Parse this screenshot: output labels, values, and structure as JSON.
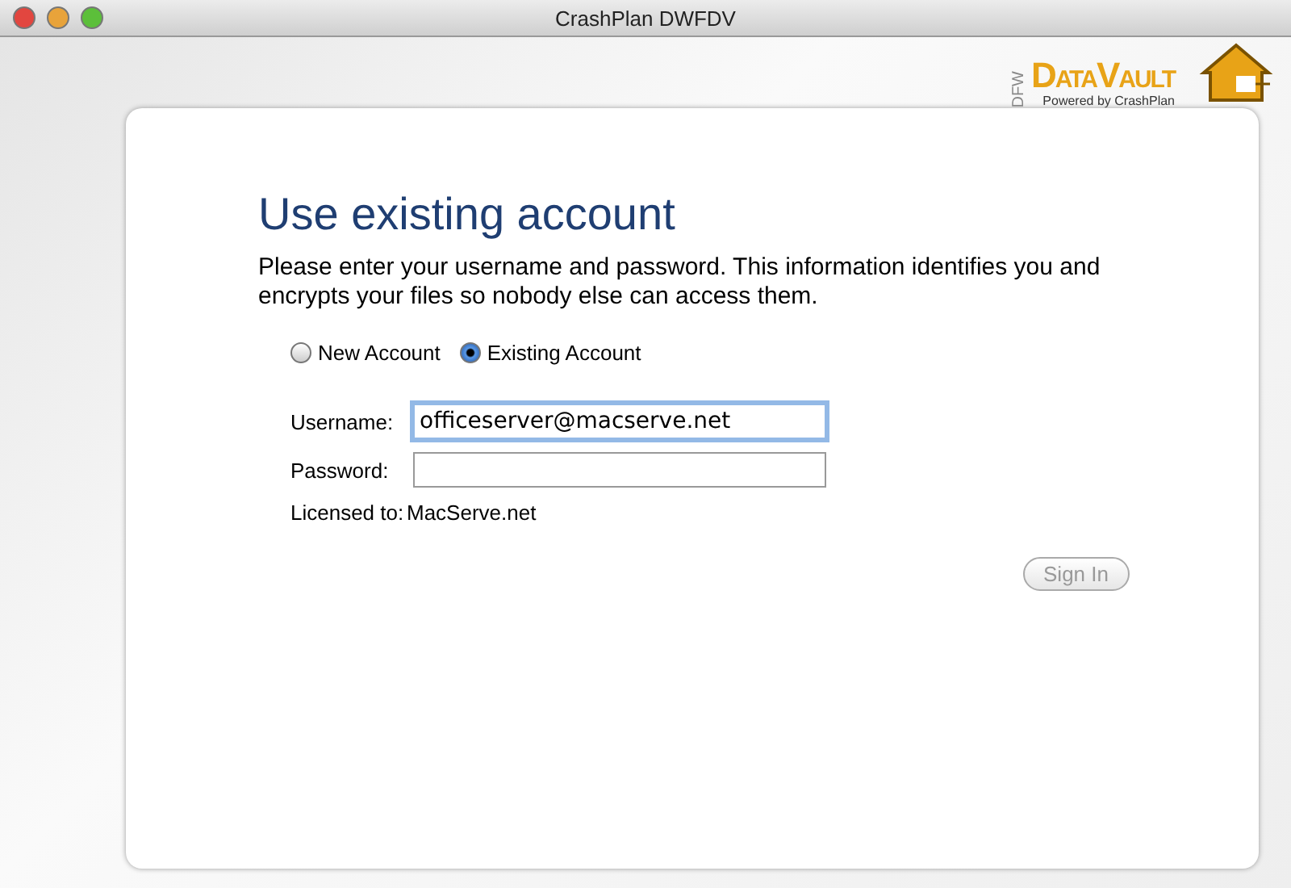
{
  "window": {
    "title": "CrashPlan DWFDV"
  },
  "logo": {
    "region": "DFW",
    "name": "DataVault",
    "tagline": "Powered by CrashPlan"
  },
  "heading": "Use existing account",
  "intro": "Please enter your username and password. This information identifies you and encrypts your files so nobody else can access them.",
  "account_types": [
    {
      "label": "New Account",
      "selected": false
    },
    {
      "label": "Existing Account",
      "selected": true
    }
  ],
  "fields": [
    {
      "label": "Username:",
      "value": "officeserver@macserve.net",
      "focused": true
    },
    {
      "label": "Password:",
      "focused": false
    }
  ],
  "license": {
    "label": "Licensed to:",
    "value": "MacServe.net"
  },
  "sign_in": {
    "label": "Sign In",
    "disabled": true
  }
}
